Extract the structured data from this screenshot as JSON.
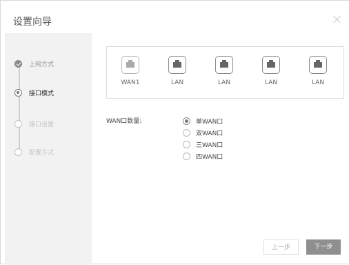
{
  "dialog": {
    "title": "设置向导"
  },
  "steps": [
    {
      "label": "上网方式",
      "state": "done"
    },
    {
      "label": "接口模式",
      "state": "active"
    },
    {
      "label": "接口设置",
      "state": "todo"
    },
    {
      "label": "配置方式",
      "state": "todo"
    }
  ],
  "ports": [
    {
      "label": "WAN1",
      "icon": "ethernet-port-icon"
    },
    {
      "label": "LAN",
      "icon": "ethernet-port-icon"
    },
    {
      "label": "LAN",
      "icon": "ethernet-port-icon"
    },
    {
      "label": "LAN",
      "icon": "ethernet-port-icon"
    },
    {
      "label": "LAN",
      "icon": "ethernet-port-icon"
    }
  ],
  "wan": {
    "label": "WAN口数量:",
    "options": [
      "单WAN口",
      "双WAN口",
      "三WAN口",
      "四WAN口"
    ],
    "selected": "单WAN口"
  },
  "buttons": {
    "prev": "上一步",
    "next": "下一步"
  }
}
